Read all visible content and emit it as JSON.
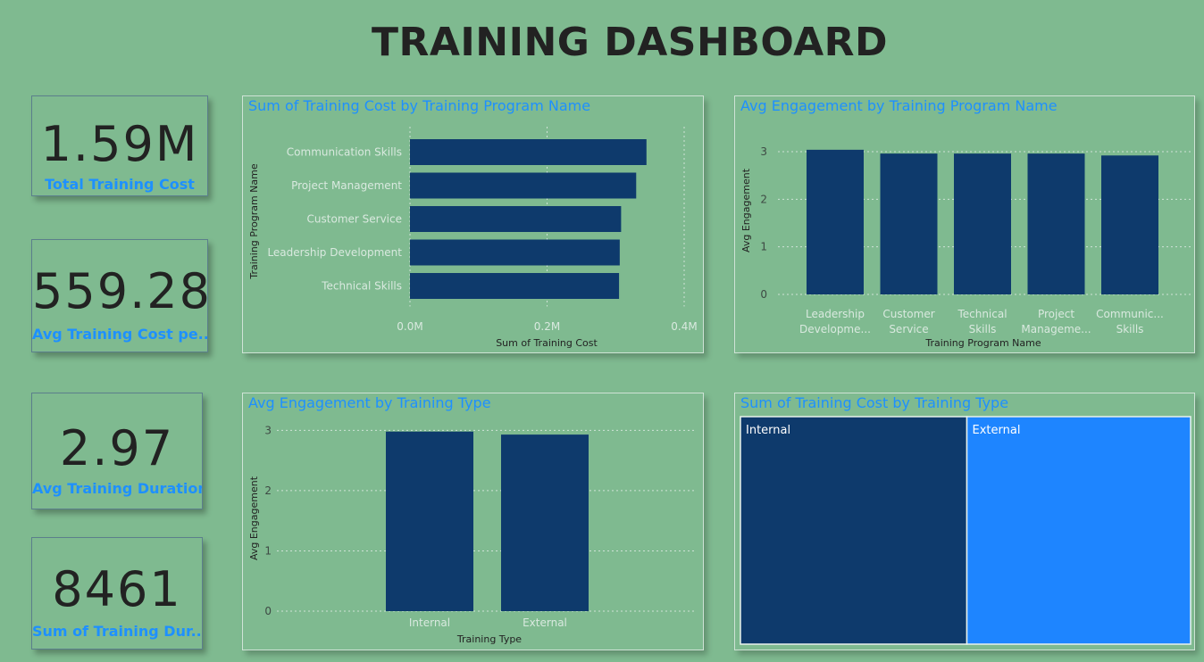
{
  "title": "TRAINING DASHBOARD",
  "cards": [
    {
      "value": "1.59M",
      "label": "Total Training Cost"
    },
    {
      "value": "559.28",
      "label": "Avg Training Cost pe..."
    },
    {
      "value": "2.97",
      "label": "Avg Training Duration"
    },
    {
      "value": "8461",
      "label": "Sum of Training Dur..."
    }
  ],
  "colors": {
    "bar": "#0e3a6c",
    "accent": "#1e90ff",
    "background": "#7fba90",
    "treemap_external": "#1e85ff"
  },
  "chart_data": [
    {
      "type": "bar",
      "orientation": "horizontal",
      "title": "Sum of Training Cost by Training Program Name",
      "xlabel": "Sum of Training Cost",
      "ylabel": "Training Program Name",
      "categories": [
        "Communication Skills",
        "Project Management",
        "Customer Service",
        "Leadership Development",
        "Technical Skills"
      ],
      "values": [
        345000,
        330000,
        308000,
        306000,
        305000
      ],
      "xlim": [
        0,
        400000
      ],
      "ticks": [
        0,
        200000,
        400000
      ],
      "tick_labels": [
        "0.0M",
        "0.2M",
        "0.4M"
      ],
      "grid": true
    },
    {
      "type": "bar",
      "title": "Avg Engagement by Training Program Name",
      "xlabel": "Training Program Name",
      "ylabel": "Avg Engagement",
      "categories": [
        [
          "Leadership",
          "Developme..."
        ],
        [
          "Customer",
          "Service"
        ],
        [
          "Technical",
          "Skills"
        ],
        [
          "Project",
          "Manageme..."
        ],
        [
          "Communic...",
          "Skills"
        ]
      ],
      "values": [
        3.04,
        2.96,
        2.96,
        2.96,
        2.92
      ],
      "ylim": [
        0,
        3.3
      ],
      "ticks": [
        0,
        1,
        2,
        3
      ],
      "grid": true
    },
    {
      "type": "bar",
      "title": "Avg Engagement by Training Type",
      "xlabel": "Training Type",
      "ylabel": "Avg Engagement",
      "categories": [
        "Internal",
        "External"
      ],
      "values": [
        2.98,
        2.93
      ],
      "ylim": [
        0,
        3.05
      ],
      "ticks": [
        0,
        1,
        2,
        3
      ],
      "grid": true
    },
    {
      "type": "treemap",
      "title": "Sum of Training Cost by Training Type",
      "categories": [
        "Internal",
        "External"
      ],
      "values": [
        50.3,
        49.7
      ]
    }
  ]
}
